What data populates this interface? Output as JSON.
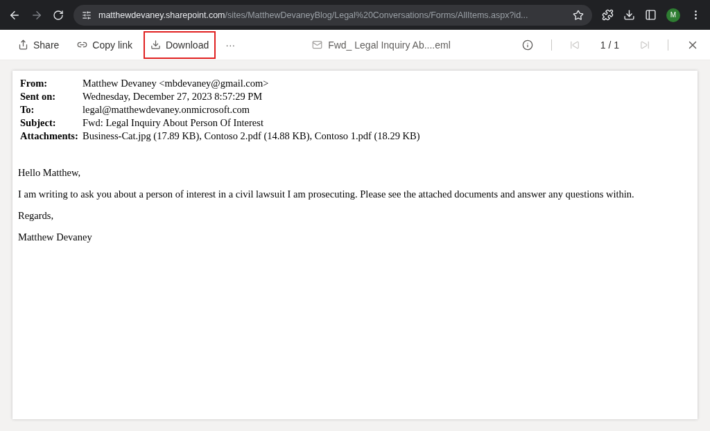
{
  "browser": {
    "url_host": "matthewdevaney.sharepoint.com",
    "url_path": "/sites/MatthewDevaneyBlog/Legal%20Conversations/Forms/AllItems.aspx?id...",
    "avatar": "M"
  },
  "toolbar": {
    "actions": [
      {
        "kind": "share",
        "label": "Share",
        "highlighted": false
      },
      {
        "kind": "link",
        "label": "Copy link",
        "highlighted": false
      },
      {
        "kind": "download",
        "label": "Download",
        "highlighted": true
      }
    ],
    "more": "···",
    "file_name": "Fwd_ Legal Inquiry Ab....eml",
    "page": "1 / 1"
  },
  "email": {
    "headers": [
      {
        "label": "From:",
        "value": "Matthew Devaney <mbdevaney@gmail.com>"
      },
      {
        "label": "Sent on:",
        "value": "Wednesday, December 27, 2023 8:57:29 PM"
      },
      {
        "label": "To:",
        "value": "legal@matthewdevaney.onmicrosoft.com"
      },
      {
        "label": "Subject:",
        "value": "Fwd: Legal Inquiry About Person Of Interest"
      },
      {
        "label": "Attachments:",
        "value": "Business-Cat.jpg (17.89 KB), Contoso 2.pdf (14.88 KB), Contoso 1.pdf (18.29 KB)"
      }
    ],
    "body": [
      "Hello Matthew,",
      "I am writing to ask you about a person of interest in a civil lawsuit I am prosecuting. Please see the attached documents and answer any questions within.",
      "Regards,",
      "Matthew Devaney"
    ]
  }
}
